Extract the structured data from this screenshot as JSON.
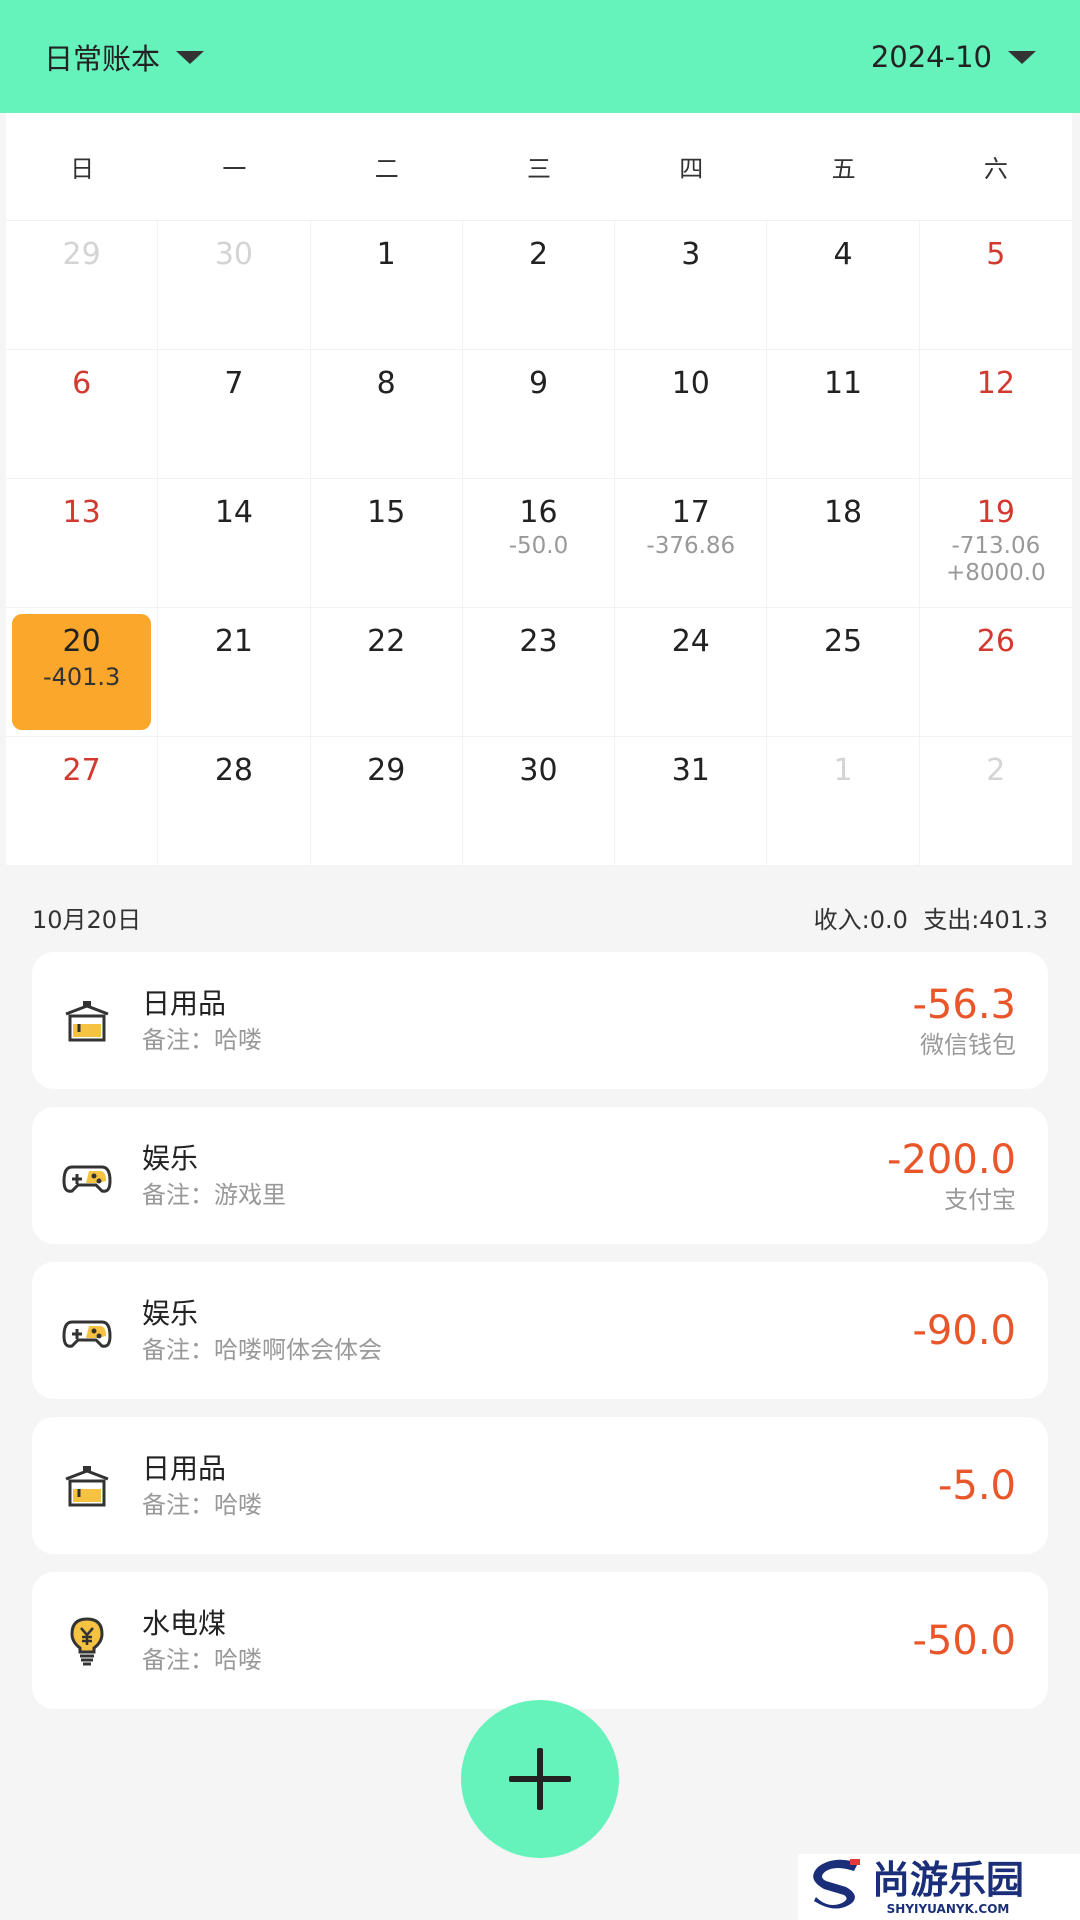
{
  "header": {
    "book": "日常账本",
    "month": "2024-10"
  },
  "calendar": {
    "weekdays": [
      "日",
      "一",
      "二",
      "三",
      "四",
      "五",
      "六"
    ],
    "days": [
      {
        "n": "29",
        "other": true
      },
      {
        "n": "30",
        "other": true
      },
      {
        "n": "1"
      },
      {
        "n": "2"
      },
      {
        "n": "3"
      },
      {
        "n": "4"
      },
      {
        "n": "5",
        "weekend": true
      },
      {
        "n": "6",
        "weekend": true
      },
      {
        "n": "7"
      },
      {
        "n": "8"
      },
      {
        "n": "9"
      },
      {
        "n": "10"
      },
      {
        "n": "11"
      },
      {
        "n": "12",
        "weekend": true
      },
      {
        "n": "13",
        "weekend": true
      },
      {
        "n": "14"
      },
      {
        "n": "15"
      },
      {
        "n": "16",
        "amounts": [
          "-50.0"
        ]
      },
      {
        "n": "17",
        "amounts": [
          "-376.86"
        ]
      },
      {
        "n": "18"
      },
      {
        "n": "19",
        "weekend": true,
        "amounts": [
          "-713.06",
          "+8000.0"
        ]
      },
      {
        "n": "20",
        "selected": true,
        "amounts": [
          "-401.3"
        ]
      },
      {
        "n": "21"
      },
      {
        "n": "22"
      },
      {
        "n": "23"
      },
      {
        "n": "24"
      },
      {
        "n": "25"
      },
      {
        "n": "26",
        "weekend": true
      },
      {
        "n": "27",
        "weekend": true
      },
      {
        "n": "28"
      },
      {
        "n": "29"
      },
      {
        "n": "30"
      },
      {
        "n": "31"
      },
      {
        "n": "1",
        "other": true
      },
      {
        "n": "2",
        "other": true
      }
    ]
  },
  "day_summary": {
    "date": "10月20日",
    "income": "收入:0.0",
    "expense": "支出:401.3"
  },
  "records": [
    {
      "icon": "daily-goods-icon",
      "category": "日用品",
      "note": "备注：哈喽",
      "amount": "-56.3",
      "wallet": "微信钱包"
    },
    {
      "icon": "gamepad-icon",
      "category": "娱乐",
      "note": "备注：游戏里",
      "amount": "-200.0",
      "wallet": "支付宝"
    },
    {
      "icon": "gamepad-icon",
      "category": "娱乐",
      "note": "备注：哈喽啊体会体会",
      "amount": "-90.0",
      "wallet": ""
    },
    {
      "icon": "daily-goods-icon",
      "category": "日用品",
      "note": "备注：哈喽",
      "amount": "-5.0",
      "wallet": ""
    },
    {
      "icon": "utility-bulb-icon",
      "category": "水电煤",
      "note": "备注：哈喽",
      "amount": "-50.0",
      "wallet": ""
    }
  ],
  "fab": {
    "icon": "plus-icon"
  },
  "watermark": {
    "title": "尚游乐园",
    "url": "SHYIYUANYK.COM"
  },
  "colors": {
    "accent": "#66f2bb",
    "selected_day": "#fba72c",
    "weekend": "#d23a2f",
    "expense": "#e8562a",
    "icon_yellow": "#f5c242"
  }
}
